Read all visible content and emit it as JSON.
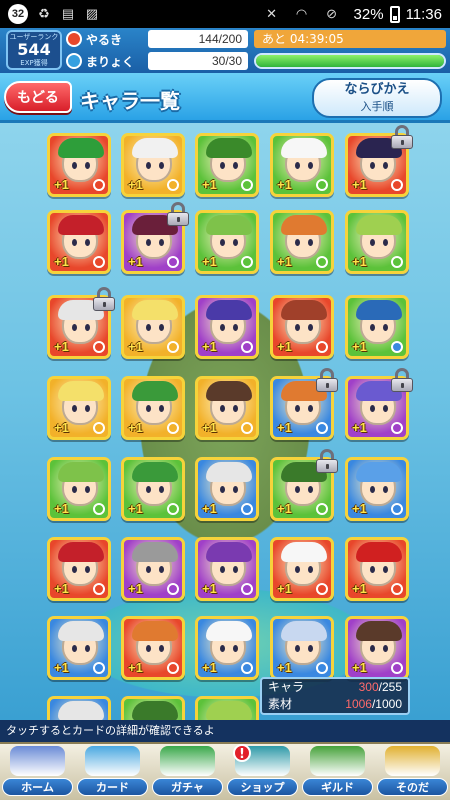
{
  "status_bar": {
    "notification_count": "32",
    "battery": "32%",
    "time": "11:36"
  },
  "header": {
    "rank_label": "ユーザーランク",
    "rank": "544",
    "rank_sub": "EXP獲得",
    "stamina_label": "やるき",
    "stamina_value": "144/200",
    "stamina_timer": "あと 04:39:05",
    "magic_label": "まりょく",
    "magic_value": "30/30",
    "magic_level": 1.0
  },
  "titlebar": {
    "back_label": "もどる",
    "title": "キャラ一覧",
    "sort_label": "ならびかえ",
    "sort_value": "入手順"
  },
  "cards": [
    {
      "bg": "#e8472b",
      "hair": "#2e9e3a",
      "element": "#e8472b",
      "plus": "+1",
      "locked": false
    },
    {
      "bg": "#f2b12a",
      "hair": "#f1f1f1",
      "element": "#f2b12a",
      "plus": "+1",
      "locked": false
    },
    {
      "bg": "#5cc23a",
      "hair": "#3a8a2a",
      "element": "#5cc23a",
      "plus": "+1",
      "locked": false
    },
    {
      "bg": "#5cc23a",
      "hair": "#f7f7f7",
      "element": "#5cc23a",
      "plus": "+1",
      "locked": false
    },
    {
      "bg": "#e8472b",
      "hair": "#2a2450",
      "element": "#e8472b",
      "plus": "+1",
      "locked": true
    },
    {
      "bg": "#e8472b",
      "hair": "#c4202a",
      "element": "#e8472b",
      "plus": "+1",
      "locked": false
    },
    {
      "bg": "#a040c8",
      "hair": "#6a1f3a",
      "element": "#a040c8",
      "plus": "+1",
      "locked": true
    },
    {
      "bg": "#5cc23a",
      "hair": "#7ec24a",
      "element": "#5cc23a",
      "plus": "+1",
      "locked": false
    },
    {
      "bg": "#5cc23a",
      "hair": "#e07a30",
      "element": "#5cc23a",
      "plus": "+1",
      "locked": false
    },
    {
      "bg": "#5cc23a",
      "hair": "#9fd050",
      "element": "#5cc23a",
      "plus": "+1",
      "locked": false
    },
    {
      "bg": "#e8472b",
      "hair": "#e6e6e6",
      "element": "#e8472b",
      "plus": "+1",
      "locked": true
    },
    {
      "bg": "#f2b12a",
      "hair": "#f4e06a",
      "element": "#f2b12a",
      "plus": "+1",
      "locked": false
    },
    {
      "bg": "#a040c8",
      "hair": "#4a3aa8",
      "element": "#a040c8",
      "plus": "+1",
      "locked": false
    },
    {
      "bg": "#e8472b",
      "hair": "#a0402a",
      "element": "#e8472b",
      "plus": "+1",
      "locked": false
    },
    {
      "bg": "#5cc23a",
      "hair": "#2a6ab8",
      "element": "#3a88e0",
      "plus": "+1",
      "locked": false
    },
    {
      "bg": "#f2b12a",
      "hair": "#f4e06a",
      "element": "#f2b12a",
      "plus": "+1",
      "locked": false
    },
    {
      "bg": "#f2b12a",
      "hair": "#3a9a3a",
      "element": "#f2b12a",
      "plus": "+1",
      "locked": false
    },
    {
      "bg": "#f2b12a",
      "hair": "#5a3a2a",
      "element": "#f2b12a",
      "plus": "+1",
      "locked": false
    },
    {
      "bg": "#3a88e0",
      "hair": "#e07a30",
      "element": "#3a88e0",
      "plus": "+1",
      "locked": true
    },
    {
      "bg": "#a040c8",
      "hair": "#6a5ad0",
      "element": "#a040c8",
      "plus": "+1",
      "locked": true
    },
    {
      "bg": "#5cc23a",
      "hair": "#7ec24a",
      "element": "#5cc23a",
      "plus": "+1",
      "locked": false
    },
    {
      "bg": "#5cc23a",
      "hair": "#3a9a3a",
      "element": "#5cc23a",
      "plus": "+1",
      "locked": false
    },
    {
      "bg": "#3a88e0",
      "hair": "#e6e6e6",
      "element": "#3a88e0",
      "plus": "+1",
      "locked": false
    },
    {
      "bg": "#5cc23a",
      "hair": "#3a7a2a",
      "element": "#5cc23a",
      "plus": "+1",
      "locked": true
    },
    {
      "bg": "#3a88e0",
      "hair": "#5aa0e8",
      "element": "#3a88e0",
      "plus": "+1",
      "locked": false
    },
    {
      "bg": "#e8472b",
      "hair": "#c4202a",
      "element": "#e8472b",
      "plus": "+1",
      "locked": false
    },
    {
      "bg": "#a040c8",
      "hair": "#9a9a9a",
      "element": "#a040c8",
      "plus": "+1",
      "locked": false
    },
    {
      "bg": "#a040c8",
      "hair": "#7a3ab0",
      "element": "#a040c8",
      "plus": "+1",
      "locked": false
    },
    {
      "bg": "#e8472b",
      "hair": "#f7f7f7",
      "element": "#e8472b",
      "plus": "+1",
      "locked": false
    },
    {
      "bg": "#e8472b",
      "hair": "#d02020",
      "element": "#e8472b",
      "plus": "+1",
      "locked": false
    },
    {
      "bg": "#3a88e0",
      "hair": "#e6e6e6",
      "element": "#3a88e0",
      "plus": "+1",
      "locked": false
    },
    {
      "bg": "#e8472b",
      "hair": "#e07a30",
      "element": "#e8472b",
      "plus": "+1",
      "locked": false
    },
    {
      "bg": "#3a88e0",
      "hair": "#f7f7f7",
      "element": "#3a88e0",
      "plus": "+1",
      "locked": false
    },
    {
      "bg": "#3a88e0",
      "hair": "#c8d8f0",
      "element": "#3a88e0",
      "plus": "+1",
      "locked": false
    },
    {
      "bg": "#a040c8",
      "hair": "#5a3a2a",
      "element": "#a040c8",
      "plus": "+1",
      "locked": false
    },
    {
      "bg": "#3a88e0",
      "hair": "#e6e6e6",
      "element": "#3a88e0",
      "plus": "",
      "locked": false
    },
    {
      "bg": "#5cc23a",
      "hair": "#3a7a2a",
      "element": "#5cc23a",
      "plus": "",
      "locked": false
    },
    {
      "bg": "#5cc23a",
      "hair": "#9fd050",
      "element": "#5cc23a",
      "plus": "",
      "locked": false
    }
  ],
  "counter": {
    "chara_label": "キャラ",
    "chara_current": "300",
    "chara_max": "/255",
    "material_label": "素材",
    "material_current": "1006",
    "material_max": "/1000"
  },
  "hint": "タッチするとカードの詳細が確認できるよ",
  "nav": [
    {
      "label": "ホーム",
      "icon": "home-icon",
      "color": "#6a8bd6",
      "alert": ""
    },
    {
      "label": "カード",
      "icon": "card-icon",
      "color": "#4aa8e0",
      "alert": ""
    },
    {
      "label": "ガチャ",
      "icon": "gacha-icon",
      "color": "#3aa84a",
      "alert": ""
    },
    {
      "label": "ショップ",
      "icon": "shop-icon",
      "color": "#2f9aa8",
      "alert": "!"
    },
    {
      "label": "ギルド",
      "icon": "guild-icon",
      "color": "#46a23a",
      "alert": ""
    },
    {
      "label": "そのだ",
      "icon": "other-icon",
      "color": "#e0b030",
      "alert": ""
    }
  ]
}
